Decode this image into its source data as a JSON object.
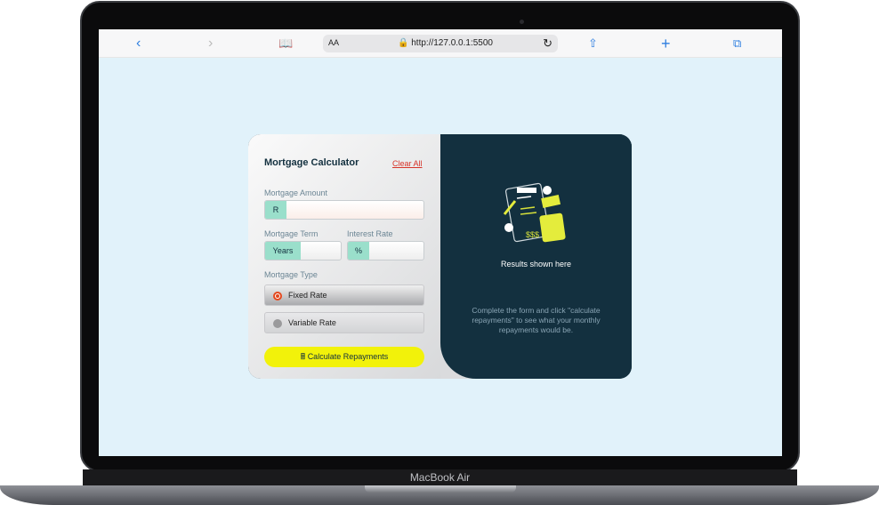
{
  "device": {
    "label": "MacBook Air"
  },
  "browser": {
    "url": "http://127.0.0.1:5500",
    "text_size": "AA"
  },
  "calculator": {
    "title": "Mortgage Calculator",
    "clear_label": "Clear All",
    "amount": {
      "label": "Mortgage Amount",
      "prefix": "R",
      "value": ""
    },
    "term": {
      "label": "Mortgage Term",
      "prefix": "Years",
      "value": ""
    },
    "rate": {
      "label": "Interest Rate",
      "prefix": "%",
      "value": ""
    },
    "type": {
      "label": "Mortgage Type",
      "options": [
        {
          "label": "Fixed Rate",
          "selected": true
        },
        {
          "label": "Variable Rate",
          "selected": false
        }
      ]
    },
    "submit_label": "Calculate Repayments"
  },
  "results": {
    "title": "Results shown here",
    "description": "Complete the form and click \"calculate repayments\" to see what your monthly repayments would be."
  },
  "colors": {
    "dark": "#13303f",
    "accent": "#f2f20a",
    "lime": "#9adfcb",
    "error": "#d73328"
  }
}
